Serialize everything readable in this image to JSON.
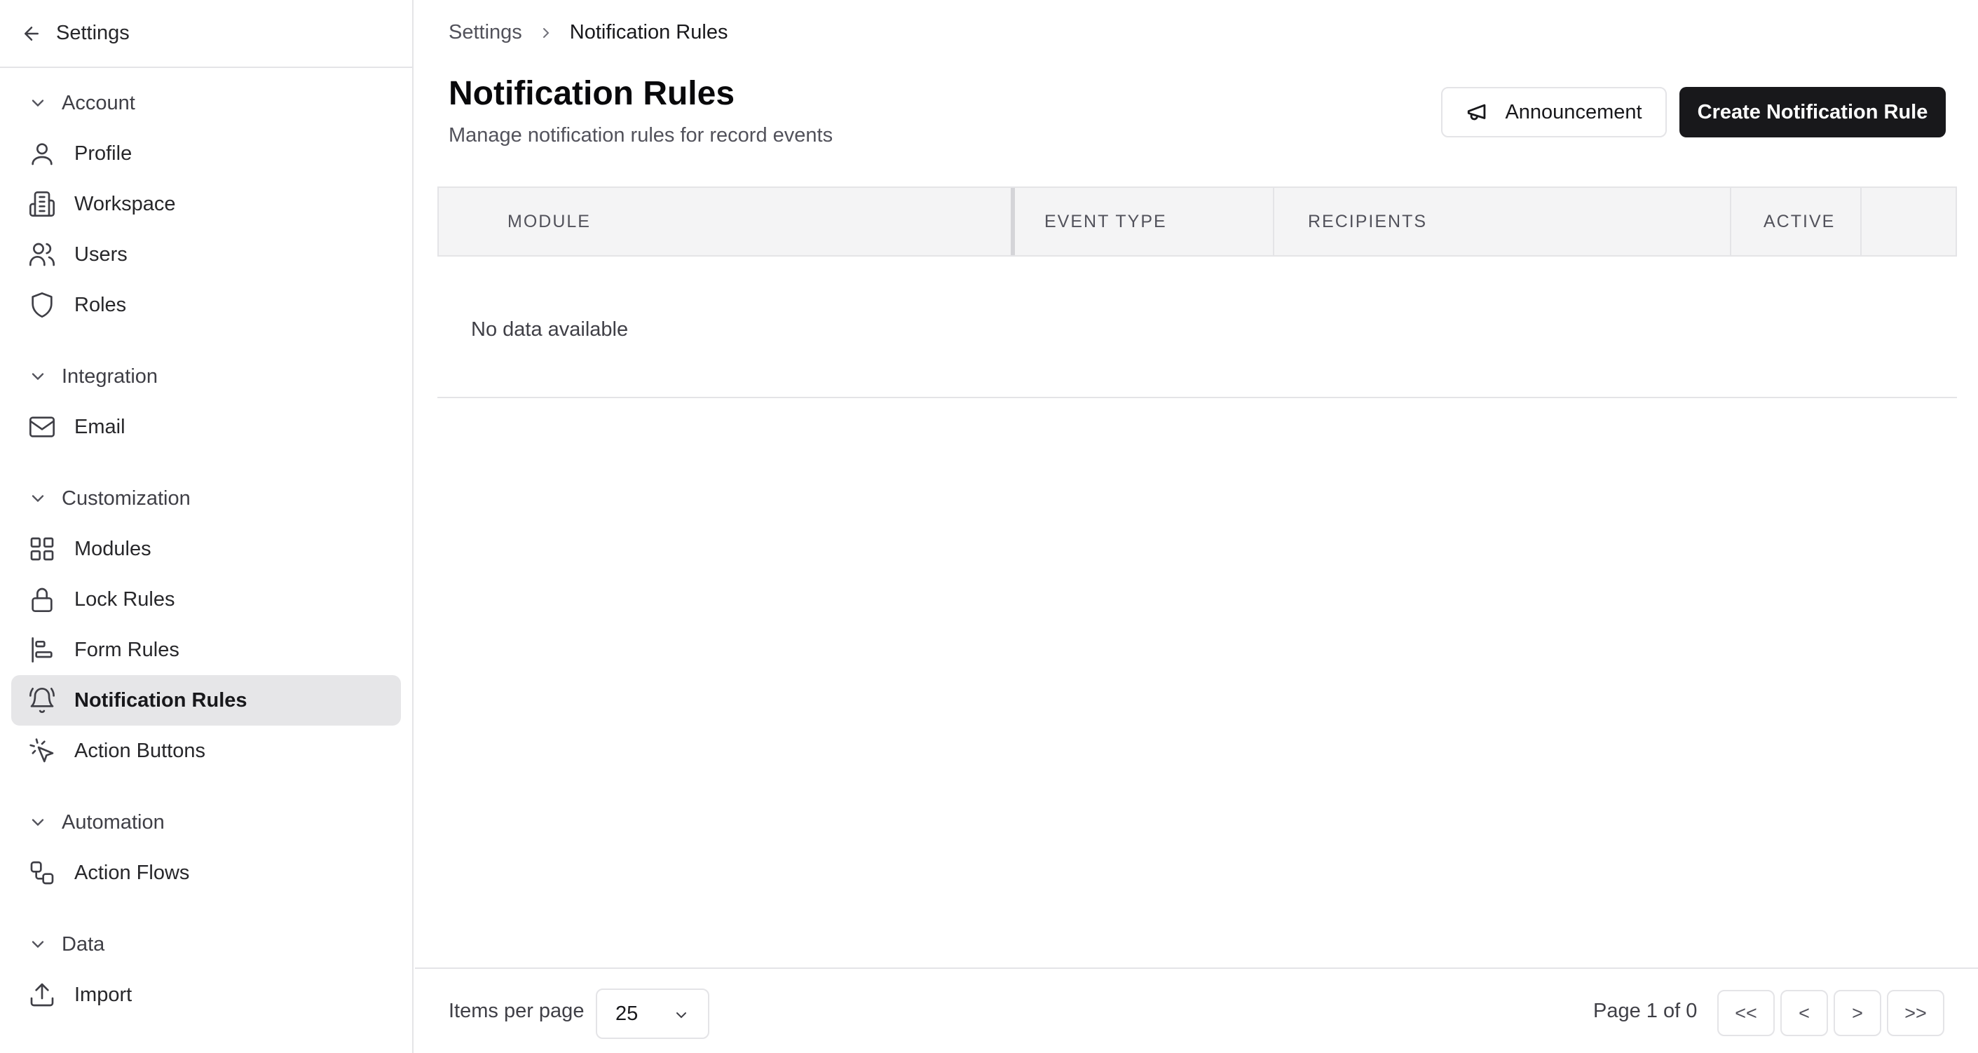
{
  "sidebar": {
    "back_label": "Settings",
    "groups": [
      {
        "label": "Account",
        "items": [
          {
            "label": "Profile",
            "icon": "user-icon"
          },
          {
            "label": "Workspace",
            "icon": "building-icon"
          },
          {
            "label": "Users",
            "icon": "users-icon"
          },
          {
            "label": "Roles",
            "icon": "shield-icon"
          }
        ]
      },
      {
        "label": "Integration",
        "items": [
          {
            "label": "Email",
            "icon": "mail-icon"
          }
        ]
      },
      {
        "label": "Customization",
        "items": [
          {
            "label": "Modules",
            "icon": "grid-icon"
          },
          {
            "label": "Lock Rules",
            "icon": "lock-icon"
          },
          {
            "label": "Form Rules",
            "icon": "align-left-icon"
          },
          {
            "label": "Notification Rules",
            "icon": "bell-icon",
            "active": true
          },
          {
            "label": "Action Buttons",
            "icon": "pointer-click-icon"
          }
        ]
      },
      {
        "label": "Automation",
        "items": [
          {
            "label": "Action Flows",
            "icon": "workflow-icon"
          }
        ]
      },
      {
        "label": "Data",
        "items": [
          {
            "label": "Import",
            "icon": "upload-icon"
          }
        ]
      }
    ]
  },
  "breadcrumb": {
    "parent": "Settings",
    "current": "Notification Rules"
  },
  "page": {
    "title": "Notification Rules",
    "subtitle": "Manage notification rules for record events"
  },
  "actions": {
    "announcement_label": "Announcement",
    "create_label": "Create Notification Rule"
  },
  "table": {
    "columns": [
      "MODULE",
      "EVENT TYPE",
      "RECIPIENTS",
      "ACTIVE",
      ""
    ],
    "empty_text": "No data available"
  },
  "pagination": {
    "items_per_page_label": "Items per page",
    "items_per_page_value": "25",
    "page_info": "Page 1 of 0",
    "first": "<<",
    "prev": "<",
    "next": ">",
    "last": ">>"
  },
  "colors": {
    "primary": "#18181b",
    "active_bg": "#e6e6e8",
    "border": "#e4e4e7"
  }
}
